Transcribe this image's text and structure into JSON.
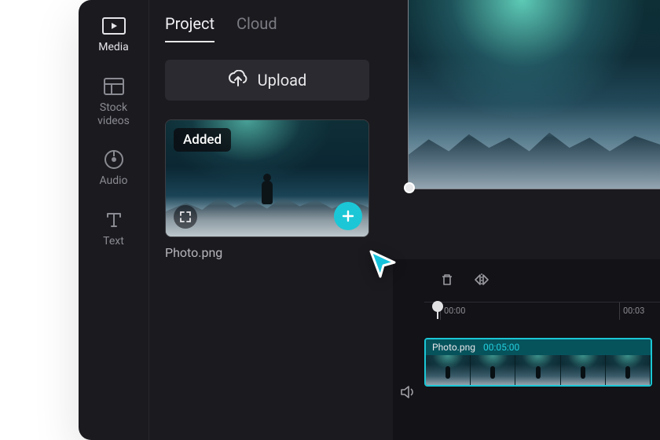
{
  "sidebar": {
    "items": [
      {
        "label": "Media"
      },
      {
        "label": "Stock\nvideos"
      },
      {
        "label": "Audio"
      },
      {
        "label": "Text"
      }
    ]
  },
  "tabs": {
    "project": "Project",
    "cloud": "Cloud"
  },
  "upload": {
    "label": "Upload"
  },
  "media": {
    "added_badge": "Added",
    "item_name": "Photo.png"
  },
  "timeline": {
    "ticks": [
      "00:00",
      "00:03"
    ],
    "clip": {
      "name": "Photo.png",
      "duration": "00:05:00"
    }
  }
}
